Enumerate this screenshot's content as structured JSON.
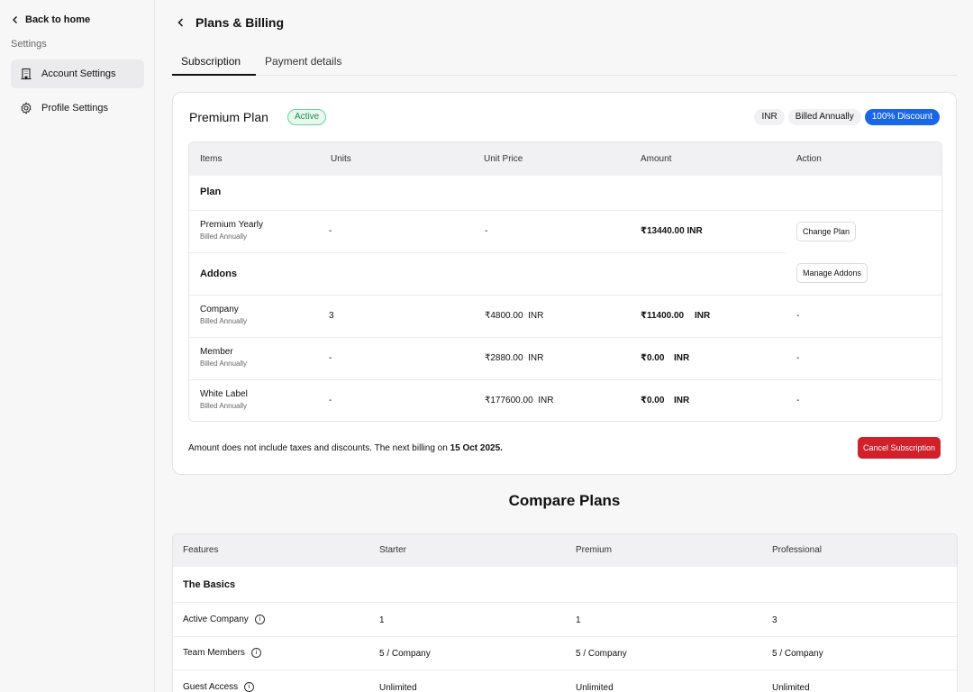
{
  "sidebar": {
    "back_label": "Back to home",
    "section_label": "Settings",
    "items": [
      {
        "label": "Account Settings",
        "icon": "building-icon"
      },
      {
        "label": "Profile Settings",
        "icon": "gear-icon"
      }
    ]
  },
  "header": {
    "title": "Plans & Billing"
  },
  "tabs": [
    {
      "label": "Subscription"
    },
    {
      "label": "Payment details"
    }
  ],
  "plan": {
    "name": "Premium Plan",
    "status": "Active",
    "chips": [
      "INR",
      "Billed Annually",
      "100% Discount"
    ]
  },
  "billing_table": {
    "headers": [
      "Items",
      "Units",
      "Unit Price",
      "Amount",
      "Action"
    ],
    "plan_section": "Plan",
    "plan_row": {
      "item": "Premium Yearly",
      "sub": "Billed Annually",
      "units": "-",
      "unit_price": "-",
      "amount": "₹13440.00 INR",
      "action": "Change Plan"
    },
    "addons_section": "Addons",
    "addons_action": "Manage Addons",
    "addon_rows": [
      {
        "item": "Company",
        "sub": "Billed Annually",
        "units": "3",
        "unit_price": "₹4800.00  INR",
        "amount": "₹11400.00",
        "currency": "INR",
        "action": "-"
      },
      {
        "item": "Member",
        "sub": "Billed Annually",
        "units": "-",
        "unit_price": "₹2880.00  INR",
        "amount": "₹0.00",
        "currency": "INR",
        "action": "-"
      },
      {
        "item": "White Label",
        "sub": "Billed Annually",
        "units": "-",
        "unit_price": "₹177600.00  INR",
        "amount": "₹0.00",
        "currency": "INR",
        "action": "-"
      }
    ]
  },
  "footnote": {
    "text": "Amount does not include taxes and discounts. The next billing on ",
    "date": "15 Oct 2025."
  },
  "cancel_label": "Cancel Subscription",
  "compare": {
    "title": "Compare Plans",
    "headers": [
      "Features",
      "Starter",
      "Premium",
      "Professional"
    ],
    "section": "The Basics",
    "rows": [
      {
        "feature": "Active Company",
        "starter": "1",
        "premium": "1",
        "professional": "3"
      },
      {
        "feature": "Team Members",
        "starter": "5 / Company",
        "premium": "5 / Company",
        "professional": "5 / Company"
      },
      {
        "feature": "Guest Access",
        "starter": "Unlimited",
        "premium": "Unlimited",
        "professional": "Unlimited"
      }
    ]
  },
  "colors": {
    "accent": "#1a66e8",
    "danger": "#d0202a",
    "success": "#1d8a4f"
  }
}
